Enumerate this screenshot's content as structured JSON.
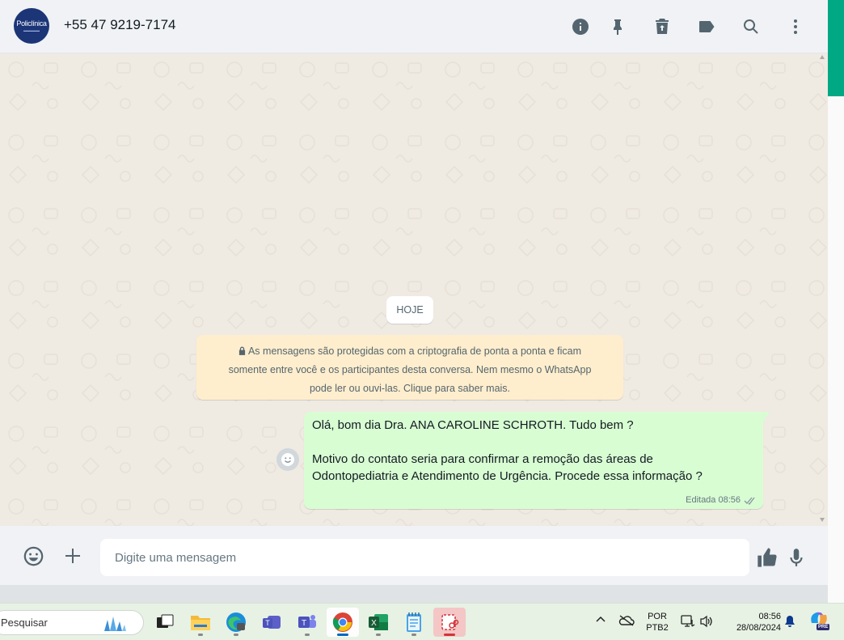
{
  "header": {
    "avatar_logo_text": "Policlínica",
    "contact_name": "+55 47 9219-7174",
    "icons": [
      "info-icon",
      "pin-icon",
      "delete-icon",
      "label-icon",
      "search-icon",
      "menu-icon"
    ]
  },
  "conversation": {
    "date_chip": "HOJE",
    "encryption_notice": {
      "line1": "As mensagens são protegidas com a criptografia de ponta a ponta e ficam",
      "line2": "somente entre você e os participantes desta conversa. Nem mesmo o WhatsApp",
      "line3": "pode ler ou ouvi-las. Clique para saber mais."
    },
    "messages": [
      {
        "direction": "outgoing",
        "line1": "Olá, bom dia Dra. ANA CAROLINE SCHROTH. Tudo bem ?",
        "line2": "Motivo do contato seria para confirmar a remoção das áreas de",
        "line3": "Odontopediatria e Atendimento de Urgência. Procede essa informação ?",
        "meta": "Editada 08:56",
        "status": "delivered"
      }
    ]
  },
  "composer": {
    "placeholder": "Digite uma mensagem",
    "icons": [
      "emoji-icon",
      "plus-icon",
      "thumbs-up-icon",
      "microphone-icon"
    ]
  },
  "taskbar": {
    "search_placeholder": "Pesquisar",
    "apps": [
      "task-view",
      "file-explorer",
      "edge",
      "teams",
      "teams-classic",
      "chrome",
      "excel",
      "notepad",
      "snipping-tool"
    ],
    "language_top": "POR",
    "language_bottom": "PTB2",
    "time": "08:56",
    "date": "28/08/2024",
    "copilot_badge": "PRE"
  },
  "colors": {
    "chat_bg": "#efeae2",
    "outgoing_bubble": "#d9fdd3",
    "notice_bg": "#ffeecd",
    "accent": "#00a884",
    "taskbar_bg": "#e7f2e4"
  }
}
